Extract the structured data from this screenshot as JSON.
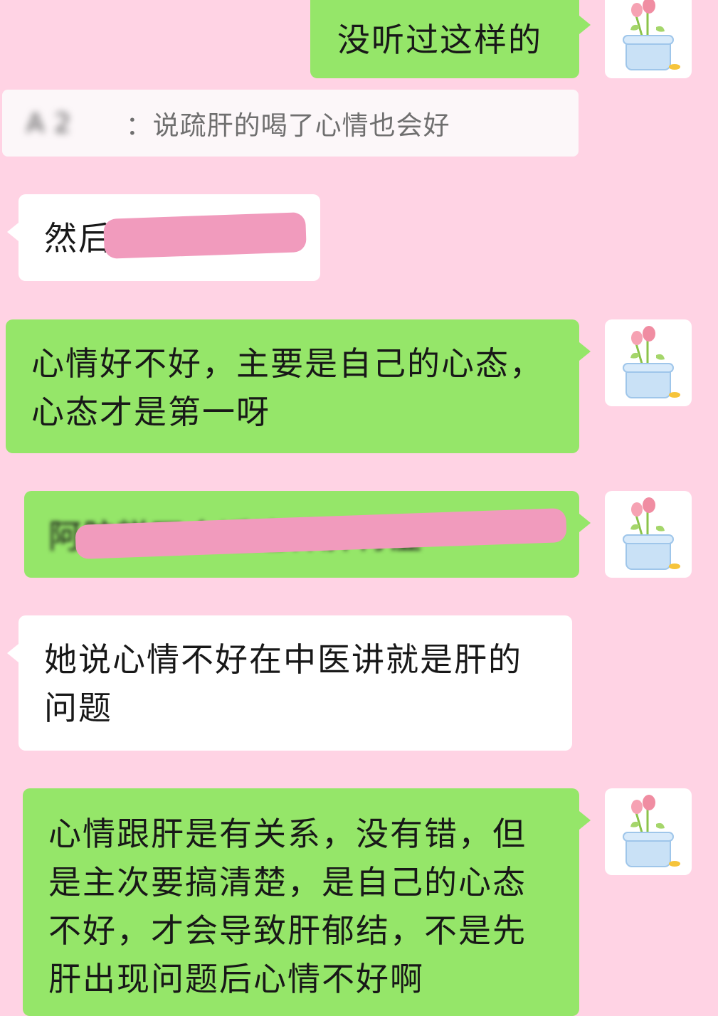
{
  "chat": {
    "messages": [
      {
        "side": "right",
        "text": "没听过这样的"
      },
      {
        "quote_name": "A 2",
        "quote_sep": "：",
        "quote_text": "说疏肝的喝了心情也会好"
      },
      {
        "side": "left",
        "text": "然后"
      },
      {
        "side": "right",
        "lines": [
          "心情好不好，主要是自己的心态，",
          "心态才是第一呀"
        ]
      },
      {
        "side": "right",
        "text": "阿胶糕不会适这种脾胃虚"
      },
      {
        "side": "left",
        "lines": [
          "她说心情不好在中医讲就是肝的",
          "问题"
        ]
      },
      {
        "side": "right",
        "lines": [
          "心情跟肝是有关系，没有错，但",
          "是主次要搞清楚，是自己的心态",
          "不好，才会导致肝郁结，不是先",
          "肝出现问题后心情不好啊"
        ]
      }
    ]
  },
  "colors": {
    "background": "#ffd3e4",
    "bubble_self": "#95e669",
    "bubble_other": "#ffffff",
    "redaction": "#f19bbd"
  },
  "avatar_icon": "tulip-pot-icon"
}
